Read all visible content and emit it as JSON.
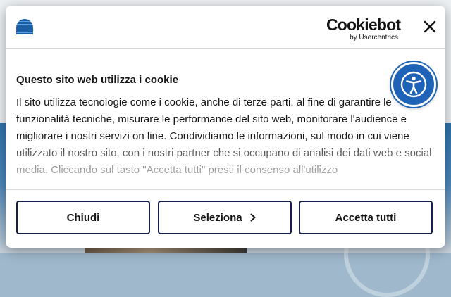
{
  "dialog": {
    "brand": "Cookiebot",
    "brand_sub": "by Usercentrics",
    "title": "Questo sito web utilizza i cookie",
    "description": "Il sito utilizza tecnologie come i cookie, anche di terze parti, al fine di garantire le funzionalità tecniche, misurare le performance del sito web, monitorare l'audience e migliorare i nostri servizi on line. Condividiamo le informazioni, sul modo in cui viene utilizzato il nostro sito, con i nostri partner che si occupano di analisi dei dati web e social media. Cliccando sul tasto \"Accetta tutti\" presti il consenso all'utilizzo",
    "buttons": {
      "close_label": "Chiudi",
      "select_label": "Seleziona",
      "accept_label": "Accetta tutti"
    }
  },
  "accent_color": "#1e63b8",
  "icons": {
    "close": "close-icon",
    "chevron": "chevron-right-icon",
    "accessibility": "accessibility-icon",
    "site_logo": "site-logo"
  }
}
